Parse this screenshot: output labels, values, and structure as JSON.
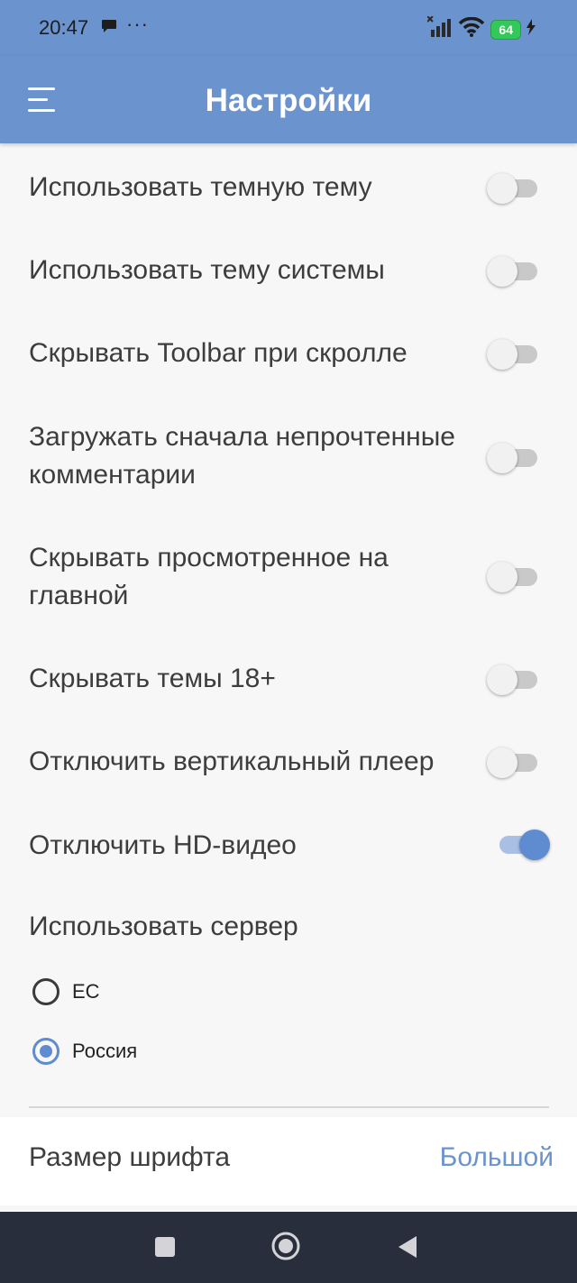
{
  "status_bar": {
    "time": "20:47",
    "dots": "···",
    "battery": "64"
  },
  "app_bar": {
    "title": "Настройки"
  },
  "settings": [
    {
      "label": "Использовать темную тему",
      "on": false
    },
    {
      "label": "Использовать тему системы",
      "on": false
    },
    {
      "label": "Скрывать Toolbar при скролле",
      "on": false
    },
    {
      "label": "Загружать сначала непрочтенные комментарии",
      "on": false
    },
    {
      "label": "Скрывать просмотренное на главной",
      "on": false
    },
    {
      "label": "Скрывать темы 18+",
      "on": false
    },
    {
      "label": "Отключить вертикальный плеер",
      "on": false
    },
    {
      "label": "Отключить HD-видео",
      "on": true
    }
  ],
  "server": {
    "title": "Использовать сервер",
    "options": [
      {
        "label": "ЕС",
        "selected": false
      },
      {
        "label": "Россия",
        "selected": true
      }
    ]
  },
  "font_size": {
    "label": "Размер шрифта",
    "value": "Большой"
  },
  "colors": {
    "accent": "#6b93cd",
    "toggle_on": "#5f8bd0",
    "nav_bar": "#282e3b"
  }
}
